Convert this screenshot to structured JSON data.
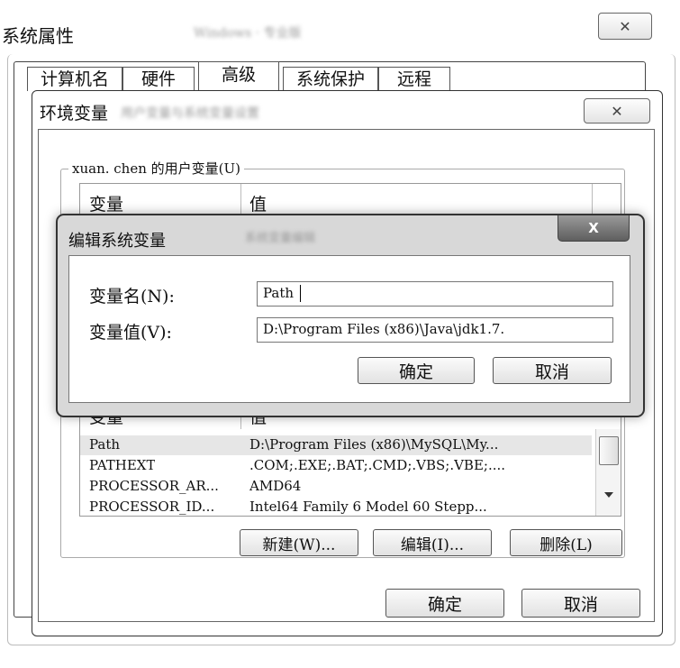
{
  "sysprops": {
    "title": "系统属性",
    "title_blur": "Windows · 专业版",
    "close": "✕",
    "tabs": [
      "计算机名",
      "硬件",
      "高级",
      "系统保护",
      "远程"
    ]
  },
  "envdlg": {
    "title": "环境变量",
    "title_blur": "用户变量与系统变量设置",
    "close": "✕",
    "user_group": "xuan. chen 的用户变量(U)",
    "col_var": "变量",
    "col_val": "值",
    "sys_col_var": "变量",
    "sys_col_val": "值",
    "sys_rows": [
      {
        "var": "Path",
        "val": "D:\\Program Files (x86)\\MySQL\\My..."
      },
      {
        "var": "PATHEXT",
        "val": ".COM;.EXE;.BAT;.CMD;.VBS;.VBE;...."
      },
      {
        "var": "PROCESSOR_AR...",
        "val": "AMD64"
      },
      {
        "var": "PROCESSOR_ID...",
        "val": "Intel64 Family 6 Model 60 Stepp..."
      }
    ],
    "new_btn": "新建(W)...",
    "edit_btn": "编辑(I)...",
    "delete_btn": "删除(L)",
    "ok": "确定",
    "cancel": "取消"
  },
  "editdlg": {
    "title": "编辑系统变量",
    "title_blur": "系统变量编辑",
    "close": "X",
    "name_label": "变量名(N):",
    "value_label": "变量值(V):",
    "name_value": "Path",
    "value_value": "D:\\Program Files (x86)\\Java\\jdk1.7.",
    "ok": "确定",
    "cancel": "取消"
  }
}
